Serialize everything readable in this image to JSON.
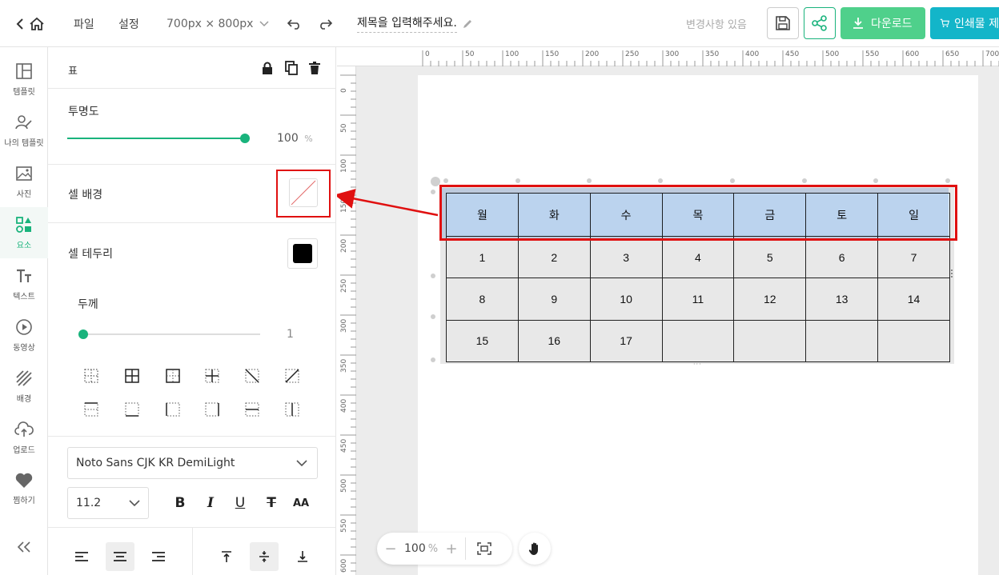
{
  "topbar": {
    "menu_file": "파일",
    "menu_settings": "설정",
    "canvas_size": "700px × 800px",
    "title": "제목을 입력해주세요.",
    "status": "변경사항 있음",
    "download_label": "다운로드",
    "print_label": "인쇄물 제"
  },
  "nav": {
    "items": [
      {
        "label": "템플릿",
        "icon": "template-icon"
      },
      {
        "label": "나의 템플릿",
        "icon": "my-template-icon"
      },
      {
        "label": "사진",
        "icon": "photo-icon"
      },
      {
        "label": "요소",
        "icon": "elements-icon"
      },
      {
        "label": "텍스트",
        "icon": "text-icon"
      },
      {
        "label": "동영상",
        "icon": "video-icon"
      },
      {
        "label": "배경",
        "icon": "background-icon"
      },
      {
        "label": "업로드",
        "icon": "upload-icon"
      },
      {
        "label": "찜하기",
        "icon": "heart-icon"
      }
    ],
    "active_index": 3
  },
  "panel": {
    "title": "표",
    "opacity_label": "투명도",
    "opacity_value": "100",
    "opacity_unit": "%",
    "opacity_fraction": 1.0,
    "cell_bg_label": "셀 배경",
    "cell_border_label": "셀 테두리",
    "border_color": "#000000",
    "thickness_label": "두께",
    "thickness_value": "1",
    "thickness_fraction": 0.0,
    "font_family": "Noto Sans CJK KR DemiLight",
    "font_size": "11.2",
    "text_case_label": "AA"
  },
  "table": {
    "header": [
      "월",
      "화",
      "수",
      "목",
      "금",
      "토",
      "일"
    ],
    "rows": [
      [
        "1",
        "2",
        "3",
        "4",
        "5",
        "6",
        "7"
      ],
      [
        "8",
        "9",
        "10",
        "11",
        "12",
        "13",
        "14"
      ],
      [
        "15",
        "16",
        "17",
        "",
        "",
        "",
        ""
      ]
    ],
    "header_bg": "#e6f3fa"
  },
  "zoom": {
    "value": "100",
    "unit": "%"
  },
  "ruler": {
    "top": [
      "0",
      "50",
      "100",
      "150",
      "200",
      "250",
      "300",
      "350",
      "400",
      "450",
      "500",
      "550",
      "600",
      "650",
      "700"
    ],
    "left": [
      "0",
      "50",
      "100",
      "150",
      "200",
      "250",
      "300",
      "350",
      "400",
      "450",
      "500",
      "550",
      "600"
    ]
  },
  "colors": {
    "accent": "#19b37c",
    "download_bg": "#4fd08b",
    "print_bg": "#13b5c9",
    "highlight": "#e01010"
  }
}
